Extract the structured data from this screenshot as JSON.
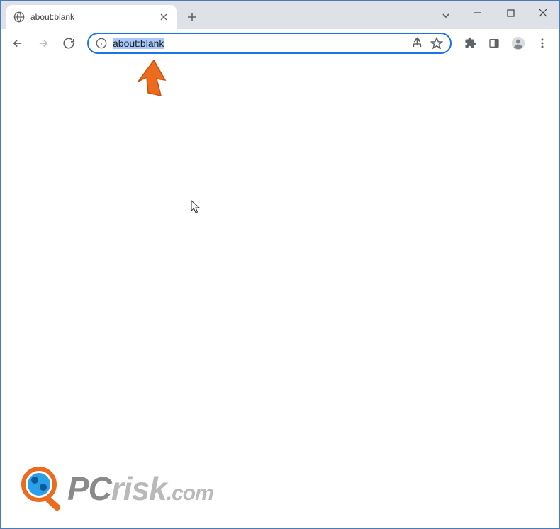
{
  "tab": {
    "title": "about:blank"
  },
  "omnibox": {
    "url": "about:blank"
  },
  "watermark": {
    "text_pc": "PC",
    "text_risk": "risk",
    "text_dom": ".com"
  },
  "colors": {
    "annotation_arrow": "#ed6b1f",
    "omnibox_focus": "#1a73e8",
    "selection_bg": "#a8c7fa"
  }
}
